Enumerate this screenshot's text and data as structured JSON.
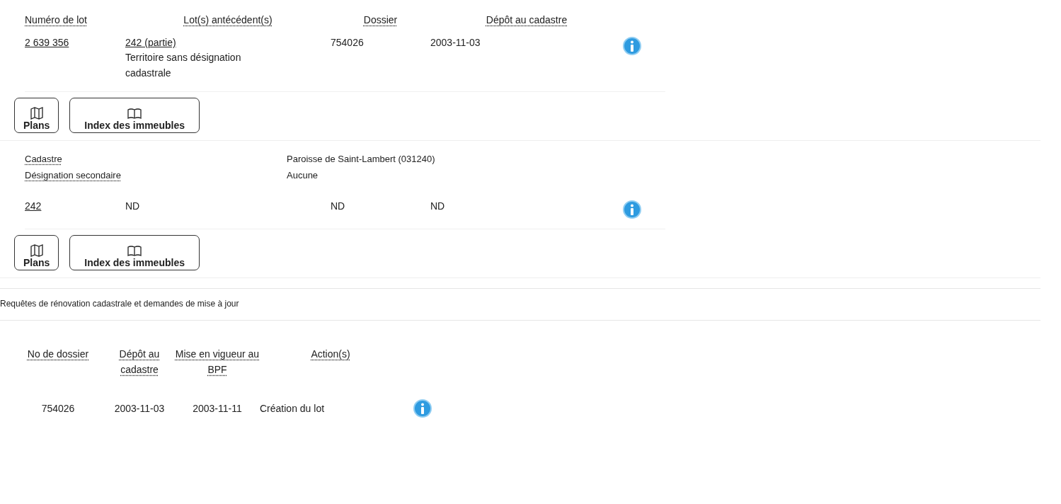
{
  "lot": {
    "columns": [
      "Numéro de lot",
      "Lot(s) antécédent(s)",
      "Dossier",
      "Dépôt au cadastre"
    ],
    "number": "2 639 356",
    "antecedent": "242 (partie)",
    "antecedent_note": "Territoire sans désignation cadastrale",
    "dossier": "754026",
    "deposit": "2003-11-03",
    "buttons": [
      {
        "label": "Plans",
        "kind": "map"
      },
      {
        "label": "Index des immeubles",
        "kind": "book"
      }
    ]
  },
  "antecedent": {
    "fields": [
      {
        "label": "Cadastre",
        "value": "Paroisse de Saint-Lambert (031240)"
      },
      {
        "label": "Désignation secondaire",
        "value": "Aucune"
      }
    ],
    "number": "242",
    "cells": [
      "ND",
      "ND",
      "ND"
    ],
    "buttons": [
      {
        "label": "Plans",
        "kind": "map"
      },
      {
        "label": "Index des immeubles",
        "kind": "book"
      }
    ]
  },
  "requests": {
    "title": "Requêtes de rénovation cadastrale et demandes de mise à jour",
    "columns": [
      "No de dossier",
      "Dépôt au cadastre",
      "Mise en vigueur au BPF",
      "Action(s)"
    ],
    "rows": [
      {
        "dossier": "754026",
        "deposit": "2003-11-03",
        "effective": "2003-11-11",
        "action": "Création du lot"
      }
    ]
  }
}
